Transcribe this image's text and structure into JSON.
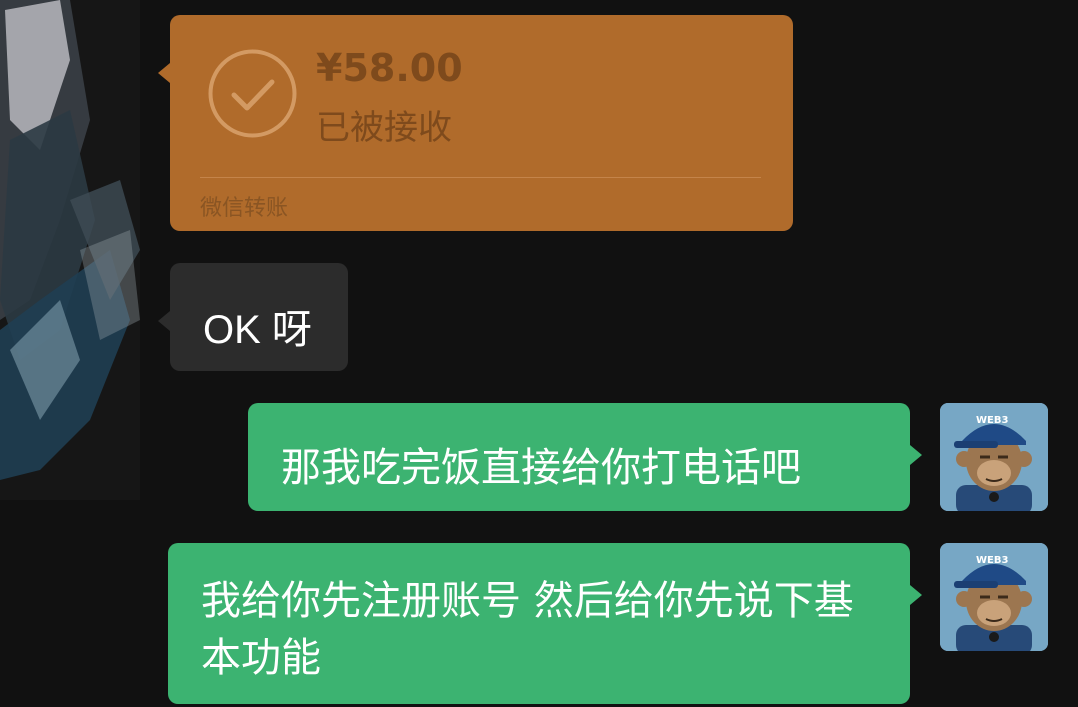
{
  "transfer": {
    "amount": "¥58.00",
    "status": "已被接收",
    "footer": "微信转账",
    "icon": "check-circle-icon",
    "color": "#B06B2B"
  },
  "messages": {
    "incoming_1": "OK 呀",
    "outgoing_1": "那我吃完饭直接给你打电话吧",
    "outgoing_2": "我给你先注册账号 然后给你先说下基本功能"
  },
  "self_avatar": {
    "cap_text": "WEB3"
  },
  "colors": {
    "background": "#111111",
    "incoming_bubble": "#2C2C2C",
    "outgoing_bubble": "#3CB371"
  }
}
